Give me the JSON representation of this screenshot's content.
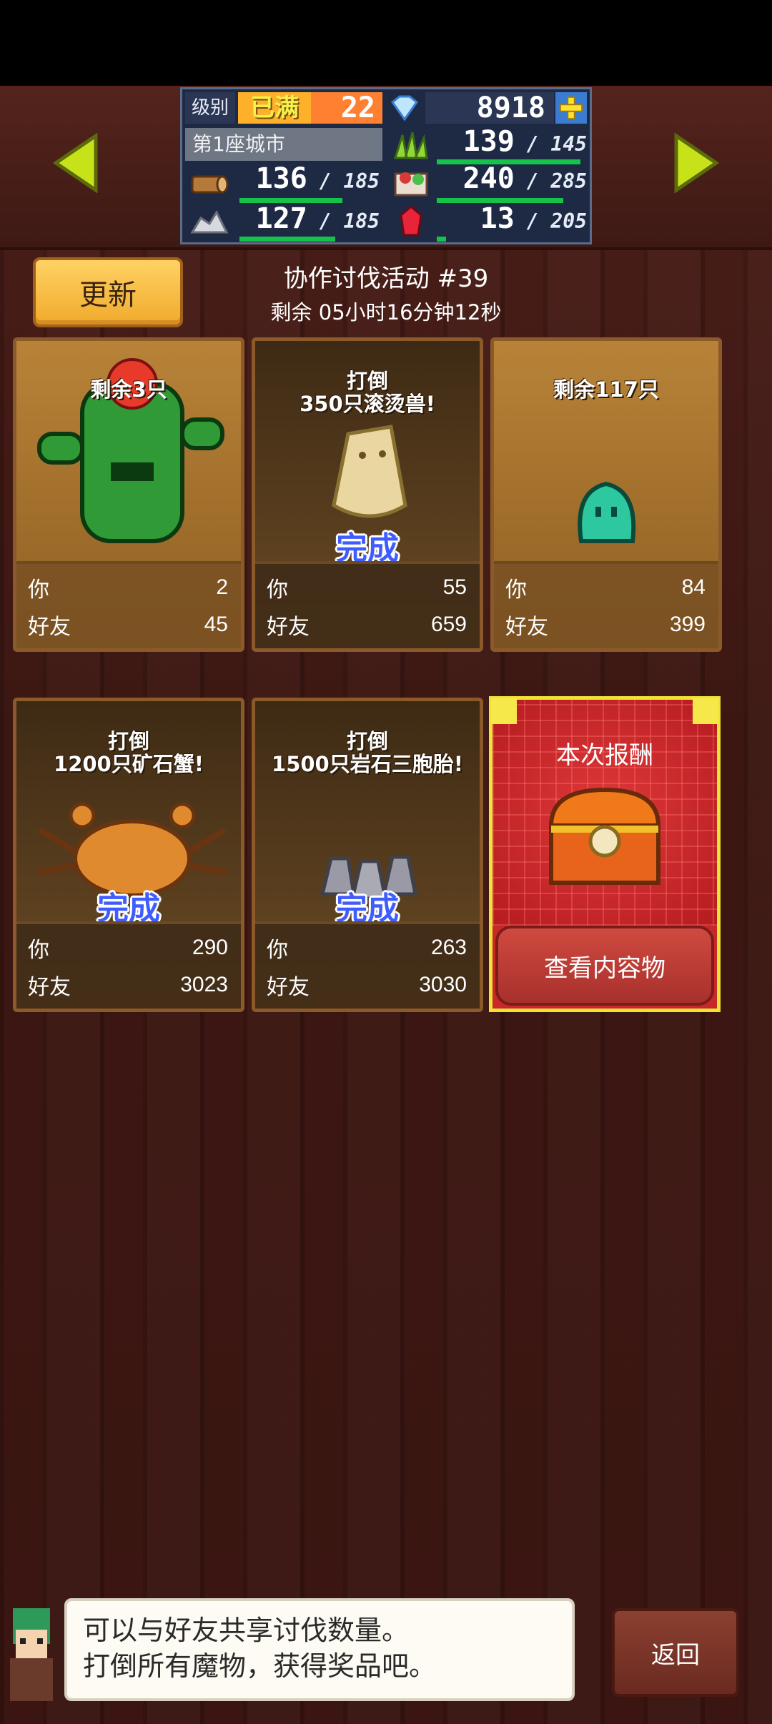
{
  "hud": {
    "level_label": "级别",
    "level_status": "已满",
    "level_value": "22",
    "gems": "8918",
    "city_name": "第1座城市",
    "resources": [
      {
        "icon": "wood-icon",
        "value": "136",
        "max": "185",
        "fill": 0.735
      },
      {
        "icon": "stone-icon",
        "value": "127",
        "max": "185",
        "fill": 0.686
      },
      {
        "icon": "grass-icon",
        "value": "139",
        "max": "145",
        "fill": 0.958
      },
      {
        "icon": "food-icon",
        "value": "240",
        "max": "285",
        "fill": 0.842
      },
      {
        "icon": "ruby-icon",
        "value": "13",
        "max": "205",
        "fill": 0.063
      }
    ]
  },
  "header": {
    "refresh_label": "更新",
    "title": "协作讨伐活动 #39",
    "time_left": "剩余 05小时16分钟12秒"
  },
  "cards": [
    {
      "title": "剩余3只",
      "you_label": "你",
      "you": "2",
      "friend_label": "好友",
      "friend": "45",
      "done": ""
    },
    {
      "title": "打倒\n350只滚烫兽!",
      "you_label": "你",
      "you": "55",
      "friend_label": "好友",
      "friend": "659",
      "done": "完成"
    },
    {
      "title": "剩余117只",
      "you_label": "你",
      "you": "84",
      "friend_label": "好友",
      "friend": "399",
      "done": ""
    },
    {
      "title": "打倒\n1200只矿石蟹!",
      "you_label": "你",
      "you": "290",
      "friend_label": "好友",
      "friend": "3023",
      "done": "完成"
    },
    {
      "title": "打倒\n1500只岩石三胞胎!",
      "you_label": "你",
      "you": "263",
      "friend_label": "好友",
      "friend": "3030",
      "done": "完成"
    }
  ],
  "reward": {
    "title": "本次报酬",
    "button": "查看内容物"
  },
  "message": {
    "line1": "可以与好友共享讨伐数量。",
    "line2": "打倒所有魔物，获得奖品吧。"
  },
  "back_label": "返回",
  "colors": {
    "done_text": "#3f5cff",
    "bar": "#16c34a",
    "reward_bg": "#c8282a",
    "button_gold": "#f0aa2c"
  }
}
